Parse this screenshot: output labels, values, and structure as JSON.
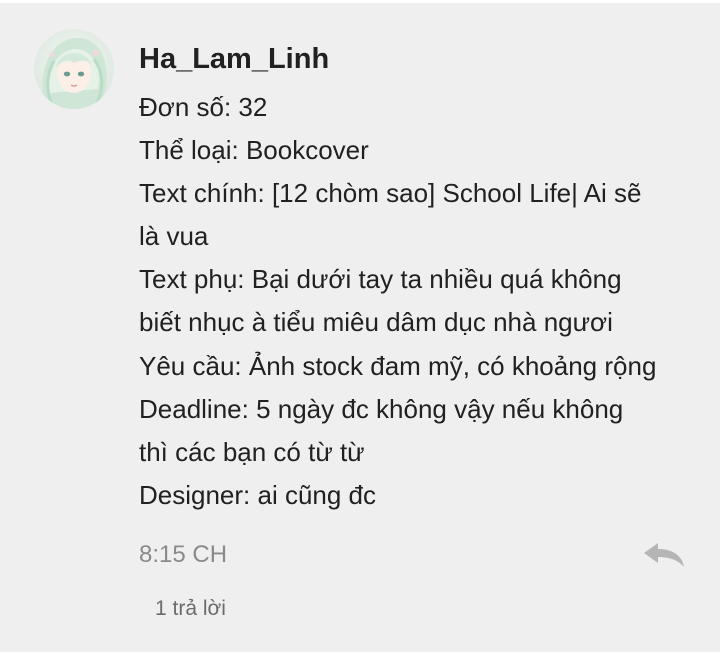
{
  "comment": {
    "author": "Ha_Lam_Linh",
    "lines": [
      "Đơn số: 32",
      "Thể loại: Bookcover",
      "Text chính: [12 chòm sao] School Life| Ai sẽ",
      "là vua",
      "Text phụ: Bại dưới tay ta nhiều quá không",
      "biết nhục à tiểu miêu dâm dục nhà ngươi",
      "Yêu cầu: Ảnh stock đam mỹ, có khoảng rộng",
      "Deadline: 5 ngày đc không vậy nếu không",
      "thì các bạn có từ từ",
      "Designer: ai cũng đc"
    ],
    "time": "8:15 CH",
    "replies_label": "1 trả lời",
    "reply_icon": "reply-arrow-icon",
    "avatar_icon": "anime-avatar"
  },
  "colors": {
    "background": "#efefef",
    "text": "#212121",
    "meta_text": "#8a8a8a",
    "icon": "#b5b5b5"
  }
}
